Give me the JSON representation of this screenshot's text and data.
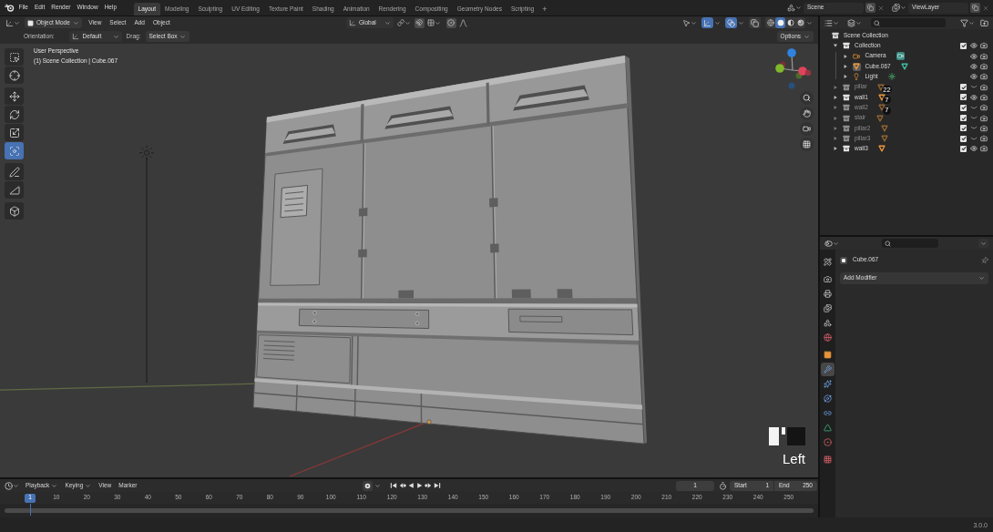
{
  "topbar": {
    "menus": [
      "File",
      "Edit",
      "Render",
      "Window",
      "Help"
    ],
    "workspaces": [
      {
        "label": "Layout",
        "selected": true
      },
      {
        "label": "Modeling",
        "selected": false
      },
      {
        "label": "Sculpting",
        "selected": false
      },
      {
        "label": "UV Editing",
        "selected": false
      },
      {
        "label": "Texture Paint",
        "selected": false
      },
      {
        "label": "Shading",
        "selected": false
      },
      {
        "label": "Animation",
        "selected": false
      },
      {
        "label": "Rendering",
        "selected": false
      },
      {
        "label": "Compositing",
        "selected": false
      },
      {
        "label": "Geometry Nodes",
        "selected": false
      },
      {
        "label": "Scripting",
        "selected": false
      }
    ],
    "add_workspace": "+",
    "scene": "Scene",
    "view_layer": "ViewLayer"
  },
  "viewport": {
    "header": {
      "mode": "Object Mode",
      "menus": [
        "View",
        "Select",
        "Add",
        "Object"
      ],
      "transform_orientation": "Global",
      "toggles": [
        {
          "kind": "gizmos",
          "on": true
        },
        {
          "kind": "overlays",
          "on": true
        },
        {
          "kind": "xray",
          "on": false
        }
      ],
      "shading_modes": [
        {
          "kind": "wireframe",
          "selected": false
        },
        {
          "kind": "solid",
          "selected": true
        },
        {
          "kind": "material",
          "selected": false
        },
        {
          "kind": "rendered",
          "selected": false
        }
      ]
    },
    "tool_settings": {
      "orientation_label": "Orientation:",
      "orientation": "Default",
      "drag_label": "Drag:",
      "drag": "Select Box",
      "options": "Options"
    },
    "tool_groups": [
      [
        {
          "kind": "select-box",
          "selected": false
        },
        {
          "kind": "cursor",
          "selected": false
        }
      ],
      [
        {
          "kind": "move",
          "selected": false
        },
        {
          "kind": "rotate",
          "selected": false
        },
        {
          "kind": "scale",
          "selected": false
        },
        {
          "kind": "transform",
          "selected": true
        }
      ],
      [
        {
          "kind": "annotate",
          "selected": false
        },
        {
          "kind": "measure",
          "selected": false
        }
      ],
      [
        {
          "kind": "add-cube",
          "selected": false
        }
      ]
    ],
    "view_name": "User Perspective",
    "context": "(1) Scene Collection | Cube.067",
    "mouse_button": "Left"
  },
  "outliner": {
    "items": [
      {
        "label": "Scene Collection",
        "kind": "scene",
        "selected": false,
        "children": [
          {
            "label": "Collection",
            "kind": "collection",
            "selected": false,
            "expanded": true,
            "checked": true,
            "visible": true,
            "children": [
              {
                "label": "Camera",
                "kind": "camera",
                "selected": false,
                "expanded": false,
                "visible": true
              },
              {
                "label": "Cube.067",
                "kind": "mesh",
                "selected": true,
                "expanded": false,
                "visible": true
              },
              {
                "label": "Light",
                "kind": "light",
                "selected": false,
                "expanded": false,
                "visible": true
              }
            ]
          },
          {
            "label": "pillar",
            "kind": "collection",
            "selected": false,
            "expanded": false,
            "checked": true,
            "visible": false,
            "count": "22"
          },
          {
            "label": "wall1",
            "kind": "collection",
            "selected": false,
            "expanded": false,
            "checked": true,
            "visible": true,
            "count": "7"
          },
          {
            "label": "wall2",
            "kind": "collection",
            "selected": false,
            "expanded": false,
            "checked": true,
            "visible": false,
            "count": "7"
          },
          {
            "label": "stair",
            "kind": "collection",
            "selected": false,
            "expanded": false,
            "checked": true,
            "visible": false
          },
          {
            "label": "pillar2",
            "kind": "collection",
            "selected": false,
            "expanded": false,
            "checked": true,
            "visible": false
          },
          {
            "label": "pillar3",
            "kind": "collection",
            "selected": false,
            "expanded": false,
            "checked": true,
            "visible": false
          },
          {
            "label": "wall3",
            "kind": "collection",
            "selected": false,
            "expanded": false,
            "checked": true,
            "visible": true
          }
        ]
      }
    ]
  },
  "properties": {
    "tab_groups": [
      [
        {
          "kind": "tool",
          "selected": false
        }
      ],
      [
        {
          "kind": "render",
          "selected": false
        },
        {
          "kind": "output",
          "selected": false
        },
        {
          "kind": "view-layer",
          "selected": false
        },
        {
          "kind": "scene",
          "selected": false
        },
        {
          "kind": "world",
          "selected": false
        }
      ],
      [
        {
          "kind": "object",
          "selected": false
        },
        {
          "kind": "modifiers",
          "selected": true
        },
        {
          "kind": "particles",
          "selected": false
        },
        {
          "kind": "physics",
          "selected": false
        },
        {
          "kind": "constraints",
          "selected": false
        },
        {
          "kind": "data",
          "selected": false
        },
        {
          "kind": "material",
          "selected": false
        }
      ],
      [
        {
          "kind": "texture",
          "selected": false
        }
      ]
    ],
    "object_name": "Cube.067",
    "add_modifier": "Add Modifier"
  },
  "timeline": {
    "menus": [
      {
        "label": "Playback",
        "kind": "popover"
      },
      {
        "label": "Keying",
        "kind": "popover"
      },
      {
        "label": "View",
        "kind": "menu"
      },
      {
        "label": "Marker",
        "kind": "menu"
      }
    ],
    "current_frame": "1",
    "start_label": "Start",
    "start": "1",
    "end_label": "End",
    "end": "250",
    "playhead": "1",
    "ticks": [
      "10",
      "20",
      "30",
      "40",
      "50",
      "60",
      "70",
      "80",
      "90",
      "100",
      "110",
      "120",
      "130",
      "140",
      "150",
      "160",
      "170",
      "180",
      "190",
      "200",
      "210",
      "220",
      "230",
      "240",
      "250"
    ]
  },
  "status_bar": {
    "version": "3.0.0"
  }
}
